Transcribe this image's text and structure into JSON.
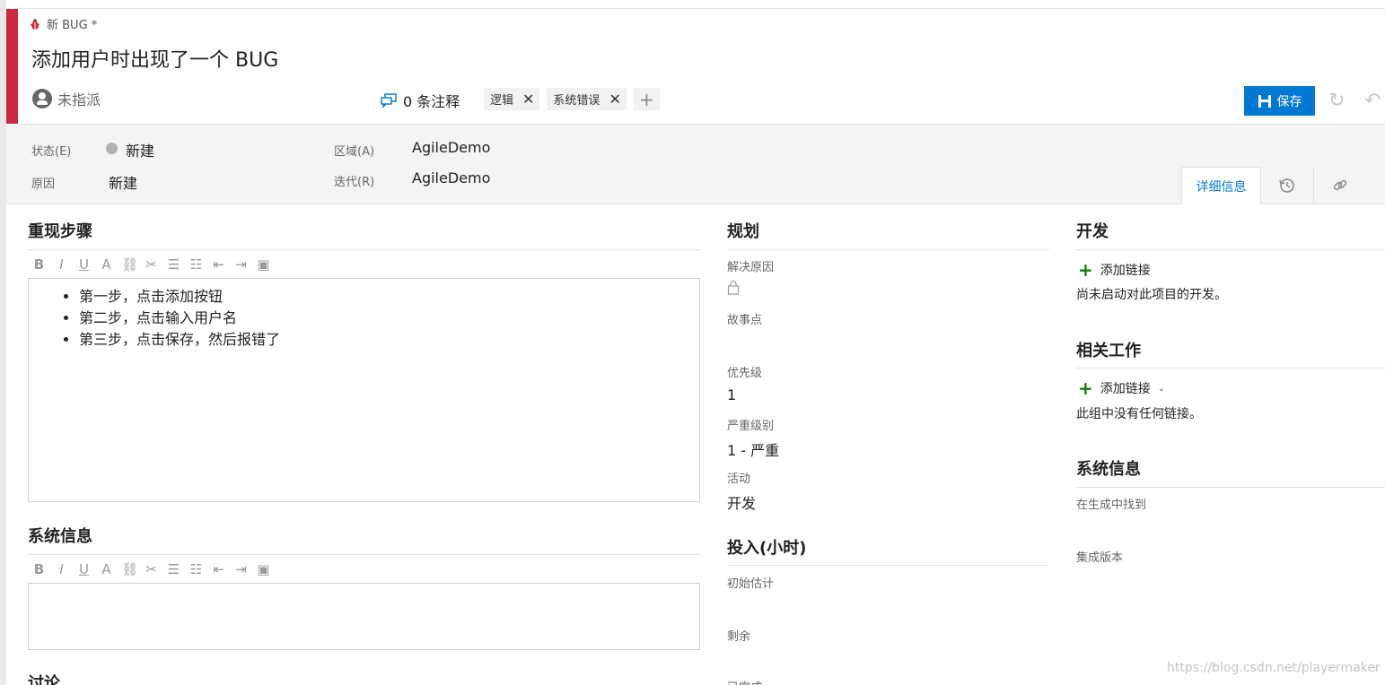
{
  "header": {
    "type_label": "新 BUG *",
    "title": "添加用户时出现了一个 BUG",
    "assignee": "未指派",
    "comments": "0 条注释",
    "tags": [
      "逻辑",
      "系统错误"
    ],
    "tag_add": "+",
    "tag_remove": "✕",
    "save_label": "保存",
    "accent_color": "#cc293d",
    "save_color": "#0078d4"
  },
  "fields": {
    "state_label": "状态(E)",
    "state_value": "新建",
    "reason_label": "原因",
    "reason_value": "新建",
    "area_label": "区域(A)",
    "area_value": "AgileDemo",
    "iteration_label": "迭代(R)",
    "iteration_value": "AgileDemo"
  },
  "tabs": {
    "details": "详细信息",
    "history_icon": "history-icon",
    "links_icon": "link-icon"
  },
  "repro": {
    "heading": "重现步骤",
    "steps": [
      "第一步，点击添加按钮",
      "第二步，点击输入用户名",
      "第三步，点击保存，然后报错了"
    ]
  },
  "sysinfo_left": {
    "heading": "系统信息"
  },
  "discussion": {
    "heading": "讨论"
  },
  "planning": {
    "heading": "规划",
    "resolved_reason_label": "解决原因",
    "story_points_label": "故事点",
    "priority_label": "优先级",
    "priority_value": "1",
    "severity_label": "严重级别",
    "severity_value": "1 - 严重",
    "activity_label": "活动",
    "activity_value": "开发"
  },
  "effort": {
    "heading": "投入(小时)",
    "original_label": "初始估计",
    "remaining_label": "剩余",
    "completed_label": "已完成"
  },
  "development": {
    "heading": "开发",
    "add_link": "添加链接",
    "note": "尚未启动对此项目的开发。"
  },
  "related": {
    "heading": "相关工作",
    "add_link": "添加链接",
    "note": "此组中没有任何链接。"
  },
  "sysinfo_right": {
    "heading": "系统信息",
    "found_in_label": "在生成中找到",
    "integrated_label": "集成版本"
  },
  "watermark": "https://blog.csdn.net/playermaker"
}
